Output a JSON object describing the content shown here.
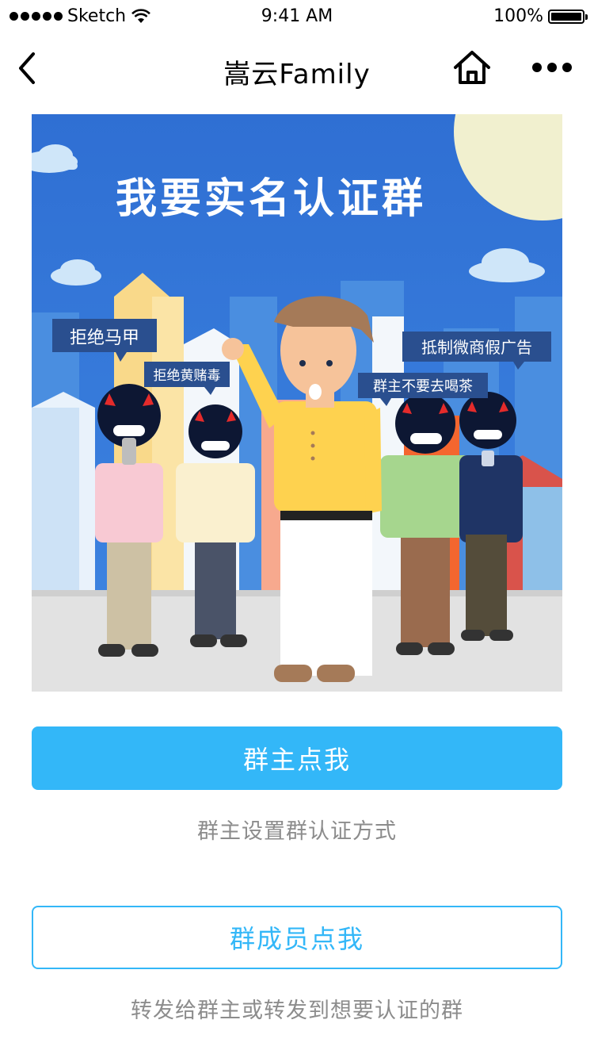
{
  "status_bar": {
    "carrier": "Sketch",
    "time": "9:41 AM",
    "battery": "100%"
  },
  "nav": {
    "title": "嵩云Family",
    "back_icon": "chevron-left-icon",
    "home_icon": "home-icon",
    "more_icon": "more-dots-icon"
  },
  "banner": {
    "headline": "我要实名认证群",
    "bubbles": [
      "拒绝马甲",
      "拒绝黄赌毒",
      "抵制微商假广告",
      "群主不要去喝茶"
    ]
  },
  "owner": {
    "button_label": "群主点我",
    "description": "群主设置群认证方式"
  },
  "member": {
    "button_label": "群成员点我",
    "description": "转发给群主或转发到想要认证的群"
  },
  "colors": {
    "accent": "#33b7f8",
    "sky": "#2f6fd3",
    "muted_text": "#8c8c8c"
  }
}
